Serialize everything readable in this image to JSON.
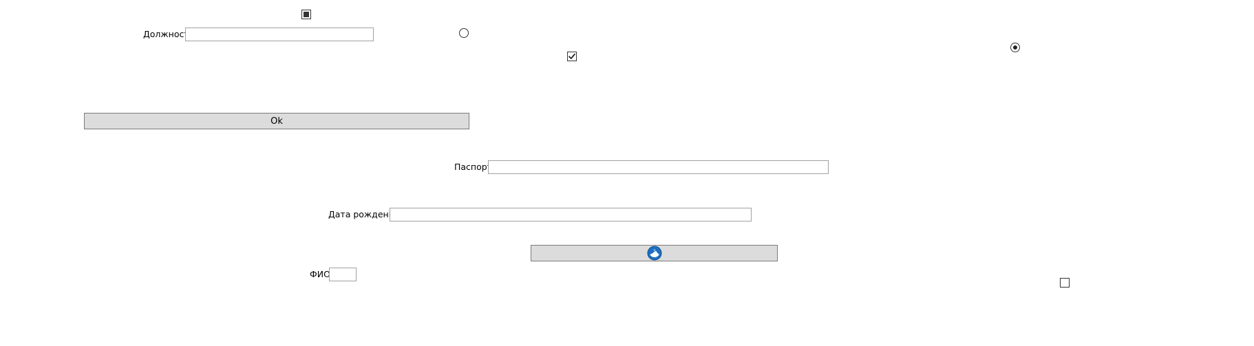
{
  "form": {
    "dolzhnost": {
      "label": "Должность",
      "value": "",
      "placeholder": ""
    },
    "pasport": {
      "label": "Паспорт",
      "value": "",
      "placeholder": ""
    },
    "data_rozhdeniya": {
      "label": "Дата рождения",
      "value": "",
      "placeholder": ""
    },
    "fio": {
      "label": "ФИО",
      "value": "",
      "placeholder": ""
    }
  },
  "buttons": {
    "ok_label": "Ok",
    "icon_button_icon": "globe-icon"
  },
  "controls": {
    "checkbox_indeterminate": {
      "state": "indeterminate"
    },
    "radio_top": {
      "state": "unchecked"
    },
    "checkbox_checked": {
      "state": "checked"
    },
    "radio_right": {
      "state": "checked"
    },
    "checkbox_bottom_right": {
      "state": "unchecked"
    }
  },
  "colors": {
    "button_bg": "#dcdcdc",
    "field_border": "#a0a0a0",
    "icon_blue": "#1f6fbf"
  }
}
